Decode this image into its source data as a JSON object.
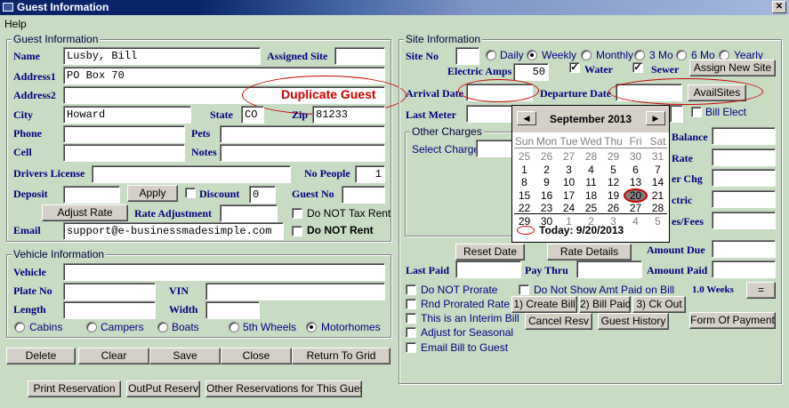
{
  "window": {
    "title": "Guest Information"
  },
  "menu": {
    "help": "Help"
  },
  "guest": {
    "group_title": "Guest Information",
    "name_label": "Name",
    "name": "Lusby, Bill",
    "assigned_site_label": "Assigned Site",
    "address1_label": "Address1",
    "address1": "PO Box 70",
    "address2_label": "Address2",
    "duplicate_banner": "Duplicate Guest",
    "city_label": "City",
    "city": "Howard",
    "state_label": "State",
    "state": "CO",
    "zip_label": "Zip",
    "zip": "81233",
    "phone_label": "Phone",
    "pets_label": "Pets",
    "cell_label": "Cell",
    "notes_label": "Notes",
    "drivers_license_label": "Drivers License",
    "no_people_label": "No People",
    "no_people": "1",
    "deposit_label": "Deposit",
    "apply_button": "Apply",
    "discount_label": "Discount",
    "discount": "0",
    "guest_no_label": "Guest No",
    "adjust_rate_button": "Adjust Rate",
    "rate_adjustment_label": "Rate Adjustment",
    "do_not_tax_rent": "Do NOT Tax Rent",
    "email_label": "Email",
    "email": "support@e-businessmadesimple.com",
    "do_not_rent": "Do NOT Rent"
  },
  "vehicle": {
    "group_title": "Vehicle Information",
    "vehicle_label": "Vehicle",
    "plate_label": "Plate No",
    "vin_label": "VIN",
    "length_label": "Length",
    "width_label": "Width",
    "types": [
      {
        "label": "Cabins",
        "selected": false
      },
      {
        "label": "Campers",
        "selected": false
      },
      {
        "label": "Boats",
        "selected": false
      },
      {
        "label": "5th Wheels",
        "selected": false
      },
      {
        "label": "Motorhomes",
        "selected": true
      }
    ]
  },
  "actions": {
    "delete": "Delete",
    "clear": "Clear",
    "save": "Save",
    "close": "Close",
    "return_to_grid": "Return To Grid"
  },
  "bottom": {
    "print_reservation": "Print Reservation",
    "output_reserv": "OutPut Reserv",
    "other_reservations": "Other Reservations for This Guest"
  },
  "site": {
    "group_title": "Site Information",
    "site_no_label": "Site No",
    "periods": [
      {
        "label": "Daily",
        "selected": false
      },
      {
        "label": "Weekly",
        "selected": true
      },
      {
        "label": "Monthly",
        "selected": false
      },
      {
        "label": "3 Mo",
        "selected": false
      },
      {
        "label": "6 Mo",
        "selected": false
      },
      {
        "label": "Yearly",
        "selected": false
      }
    ],
    "electric_amps_label": "Electric Amps",
    "electric_amps": "50",
    "water_label": "Water",
    "water_checked": true,
    "sewer_label": "Sewer",
    "sewer_checked": true,
    "assign_new_site_button": "Assign New Site",
    "arrival_date_label": "Arrival Date",
    "departure_date_label": "Departure Date",
    "avail_sites_button": "AvailSites",
    "last_meter_label": "Last Meter",
    "bill_elect_label": "Bill Elect",
    "other_charges_title": "Other Charges",
    "select_charge_label": "Select Charge",
    "balance_label": "Balance",
    "rate_label": "Rate",
    "other_chg_label": "er Chg",
    "electric_label": "ctric",
    "taxes_fees_label": "es/Fees",
    "reset_date_button": "Reset Date",
    "rate_details_button": "Rate Details",
    "amount_due_label": "Amount Due",
    "last_paid_label": "Last Paid",
    "pay_thru_label": "Pay Thru",
    "amount_paid_label": "Amount Paid",
    "do_not_prorate": "Do NOT Prorate",
    "do_not_show_amt": "Do Not Show Amt Paid on Bill",
    "weeks_label": "1.0 Weeks",
    "equals_button": "=",
    "rnd_prorated_rate": "Rnd Prorated Rate",
    "create_bill_button": "1) Create Bill",
    "bill_paid_button": "2) Bill Paid",
    "ck_out_button": "3) Ck Out",
    "interim_bill": "This is an Interim Bill",
    "cancel_resv_button": "Cancel Resv",
    "guest_history_button": "Guest History",
    "form_of_payment_button": "Form Of Payment",
    "adjust_seasonal": "Adjust for Seasonal",
    "email_bill": "Email Bill to Guest"
  },
  "calendar": {
    "month": "September 2013",
    "dow": [
      "Sun",
      "Mon",
      "Tue",
      "Wed",
      "Thu",
      "Fri",
      "Sat"
    ],
    "weeks": [
      [
        "25",
        "26",
        "27",
        "28",
        "29",
        "30",
        "31"
      ],
      [
        "1",
        "2",
        "3",
        "4",
        "5",
        "6",
        "7"
      ],
      [
        "8",
        "9",
        "10",
        "11",
        "12",
        "13",
        "14"
      ],
      [
        "15",
        "16",
        "17",
        "18",
        "19",
        "20",
        "21"
      ],
      [
        "22",
        "23",
        "24",
        "25",
        "26",
        "27",
        "28"
      ],
      [
        "29",
        "30",
        "1",
        "2",
        "3",
        "4",
        "5"
      ]
    ],
    "selected_day": "20",
    "today_label": "Today: 9/20/2013"
  }
}
